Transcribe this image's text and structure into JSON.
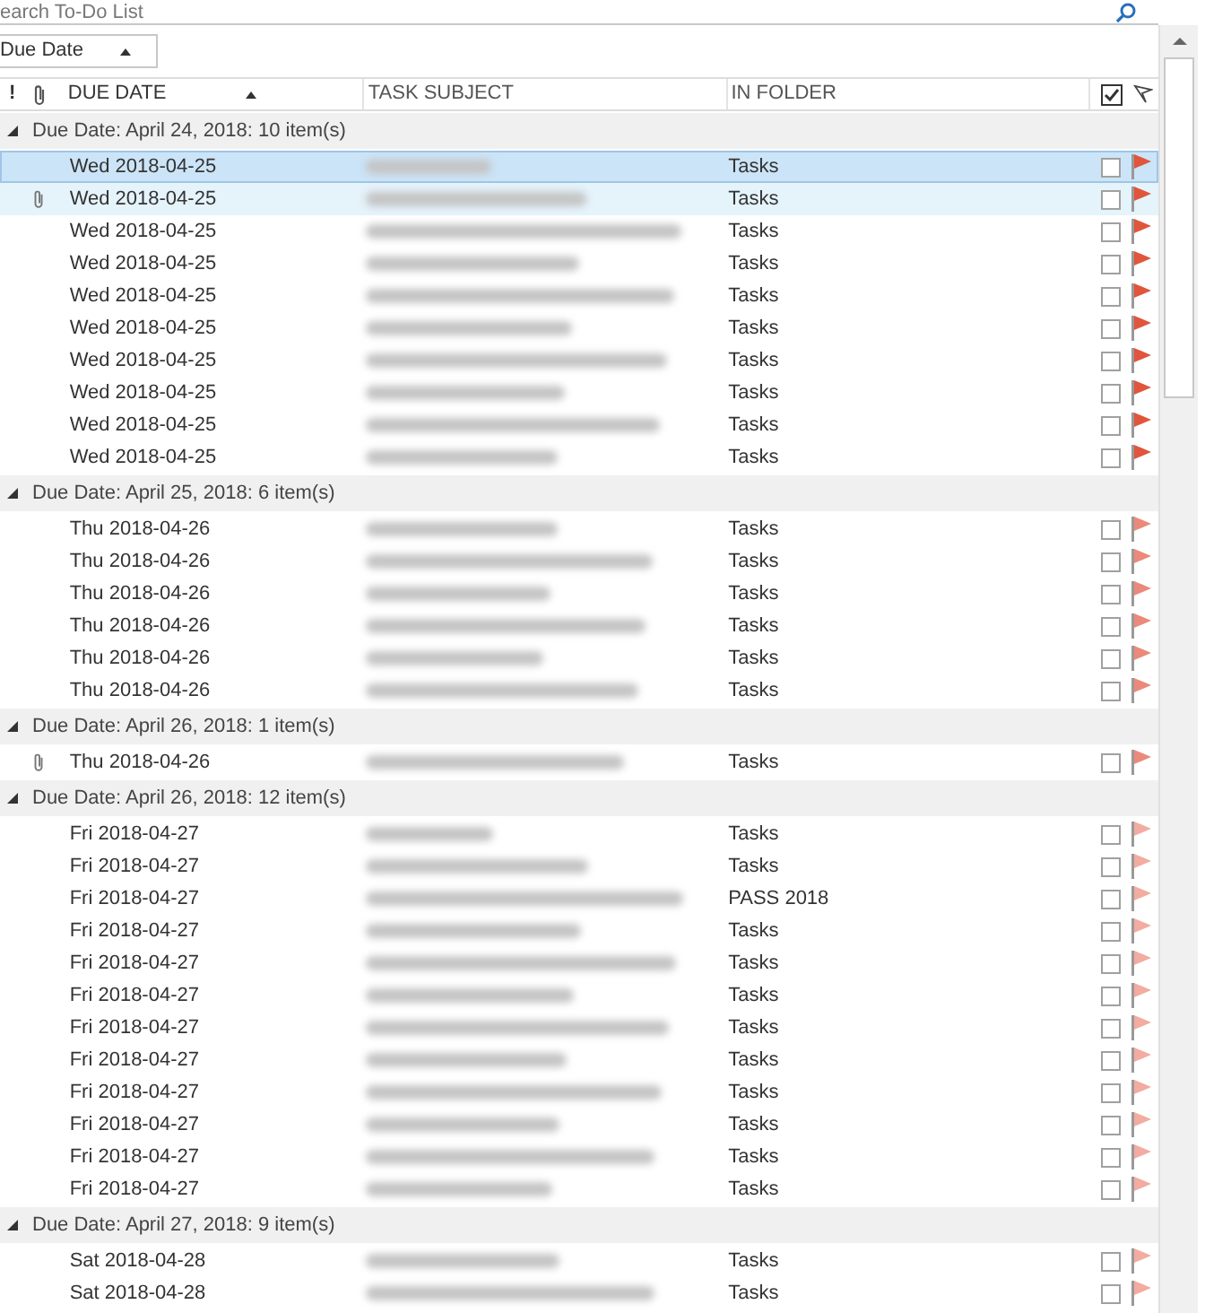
{
  "search": {
    "placeholder": "earch To-Do List"
  },
  "arrange_by": {
    "label": "Due Date"
  },
  "columns": [
    {
      "kind": "icon",
      "label": "!"
    },
    {
      "kind": "attachment"
    },
    {
      "kind": "text",
      "label": "DUE DATE",
      "sorted": true
    },
    {
      "kind": "text",
      "label": "TASK SUBJECT",
      "sorted": false
    },
    {
      "kind": "text",
      "label": "IN FOLDER",
      "sorted": false
    },
    {
      "kind": "complete"
    },
    {
      "kind": "flag"
    }
  ],
  "groups": [
    {
      "label": "Due Date: April 24, 2018: 10 item(s)",
      "expanded": true,
      "rows": [
        {
          "due": "Wed 2018-04-25",
          "folder": "Tasks",
          "selected": true,
          "hover": false,
          "attachment": false,
          "complete": false,
          "color": "#e0553c"
        },
        {
          "due": "Wed 2018-04-25",
          "folder": "Tasks",
          "selected": false,
          "hover": true,
          "attachment": true,
          "complete": false,
          "color": "#e0553c"
        },
        {
          "due": "Wed 2018-04-25",
          "folder": "Tasks",
          "selected": false,
          "hover": false,
          "attachment": false,
          "complete": false,
          "color": "#e0553c"
        },
        {
          "due": "Wed 2018-04-25",
          "folder": "Tasks",
          "selected": false,
          "hover": false,
          "attachment": false,
          "complete": false,
          "color": "#e0553c"
        },
        {
          "due": "Wed 2018-04-25",
          "folder": "Tasks",
          "selected": false,
          "hover": false,
          "attachment": false,
          "complete": false,
          "color": "#e0553c"
        },
        {
          "due": "Wed 2018-04-25",
          "folder": "Tasks",
          "selected": false,
          "hover": false,
          "attachment": false,
          "complete": false,
          "color": "#e0553c"
        },
        {
          "due": "Wed 2018-04-25",
          "folder": "Tasks",
          "selected": false,
          "hover": false,
          "attachment": false,
          "complete": false,
          "color": "#e0553c"
        },
        {
          "due": "Wed 2018-04-25",
          "folder": "Tasks",
          "selected": false,
          "hover": false,
          "attachment": false,
          "complete": false,
          "color": "#e0553c"
        },
        {
          "due": "Wed 2018-04-25",
          "folder": "Tasks",
          "selected": false,
          "hover": false,
          "attachment": false,
          "complete": false,
          "color": "#e0553c"
        },
        {
          "due": "Wed 2018-04-25",
          "folder": "Tasks",
          "selected": false,
          "hover": false,
          "attachment": false,
          "complete": false,
          "color": "#e0553c"
        }
      ]
    },
    {
      "label": "Due Date: April 25, 2018: 6 item(s)",
      "expanded": true,
      "rows": [
        {
          "due": "Thu 2018-04-26",
          "folder": "Tasks",
          "selected": false,
          "hover": false,
          "attachment": false,
          "complete": false,
          "color": "#eb8a7a"
        },
        {
          "due": "Thu 2018-04-26",
          "folder": "Tasks",
          "selected": false,
          "hover": false,
          "attachment": false,
          "complete": false,
          "color": "#eb8a7a"
        },
        {
          "due": "Thu 2018-04-26",
          "folder": "Tasks",
          "selected": false,
          "hover": false,
          "attachment": false,
          "complete": false,
          "color": "#eb8a7a"
        },
        {
          "due": "Thu 2018-04-26",
          "folder": "Tasks",
          "selected": false,
          "hover": false,
          "attachment": false,
          "complete": false,
          "color": "#eb8a7a"
        },
        {
          "due": "Thu 2018-04-26",
          "folder": "Tasks",
          "selected": false,
          "hover": false,
          "attachment": false,
          "complete": false,
          "color": "#eb8a7a"
        },
        {
          "due": "Thu 2018-04-26",
          "folder": "Tasks",
          "selected": false,
          "hover": false,
          "attachment": false,
          "complete": false,
          "color": "#eb8a7a"
        }
      ]
    },
    {
      "label": "Due Date: April 26, 2018: 1 item(s)",
      "expanded": true,
      "rows": [
        {
          "due": "Thu 2018-04-26",
          "folder": "Tasks",
          "selected": false,
          "hover": false,
          "attachment": true,
          "complete": false,
          "color": "#eb8a7a"
        }
      ]
    },
    {
      "label": "Due Date: April 26, 2018: 12 item(s)",
      "expanded": true,
      "rows": [
        {
          "due": "Fri 2018-04-27",
          "folder": "Tasks",
          "selected": false,
          "hover": false,
          "attachment": false,
          "complete": false,
          "color": "#f2aca0"
        },
        {
          "due": "Fri 2018-04-27",
          "folder": "Tasks",
          "selected": false,
          "hover": false,
          "attachment": false,
          "complete": false,
          "color": "#f2aca0"
        },
        {
          "due": "Fri 2018-04-27",
          "folder": "PASS 2018",
          "selected": false,
          "hover": false,
          "attachment": false,
          "complete": false,
          "color": "#f2aca0"
        },
        {
          "due": "Fri 2018-04-27",
          "folder": "Tasks",
          "selected": false,
          "hover": false,
          "attachment": false,
          "complete": false,
          "color": "#f2aca0"
        },
        {
          "due": "Fri 2018-04-27",
          "folder": "Tasks",
          "selected": false,
          "hover": false,
          "attachment": false,
          "complete": false,
          "color": "#f2aca0"
        },
        {
          "due": "Fri 2018-04-27",
          "folder": "Tasks",
          "selected": false,
          "hover": false,
          "attachment": false,
          "complete": false,
          "color": "#f2aca0"
        },
        {
          "due": "Fri 2018-04-27",
          "folder": "Tasks",
          "selected": false,
          "hover": false,
          "attachment": false,
          "complete": false,
          "color": "#f2aca0"
        },
        {
          "due": "Fri 2018-04-27",
          "folder": "Tasks",
          "selected": false,
          "hover": false,
          "attachment": false,
          "complete": false,
          "color": "#f2aca0"
        },
        {
          "due": "Fri 2018-04-27",
          "folder": "Tasks",
          "selected": false,
          "hover": false,
          "attachment": false,
          "complete": false,
          "color": "#f2aca0"
        },
        {
          "due": "Fri 2018-04-27",
          "folder": "Tasks",
          "selected": false,
          "hover": false,
          "attachment": false,
          "complete": false,
          "color": "#f2aca0"
        },
        {
          "due": "Fri 2018-04-27",
          "folder": "Tasks",
          "selected": false,
          "hover": false,
          "attachment": false,
          "complete": false,
          "color": "#f2aca0"
        },
        {
          "due": "Fri 2018-04-27",
          "folder": "Tasks",
          "selected": false,
          "hover": false,
          "attachment": false,
          "complete": false,
          "color": "#f2aca0"
        }
      ]
    },
    {
      "label": "Due Date: April 27, 2018: 9 item(s)",
      "expanded": true,
      "rows": [
        {
          "due": "Sat 2018-04-28",
          "folder": "Tasks",
          "selected": false,
          "hover": false,
          "attachment": false,
          "complete": false,
          "color": "#f2aca0"
        },
        {
          "due": "Sat 2018-04-28",
          "folder": "Tasks",
          "selected": false,
          "hover": false,
          "attachment": false,
          "complete": false,
          "color": "#f2aca0"
        }
      ]
    }
  ]
}
